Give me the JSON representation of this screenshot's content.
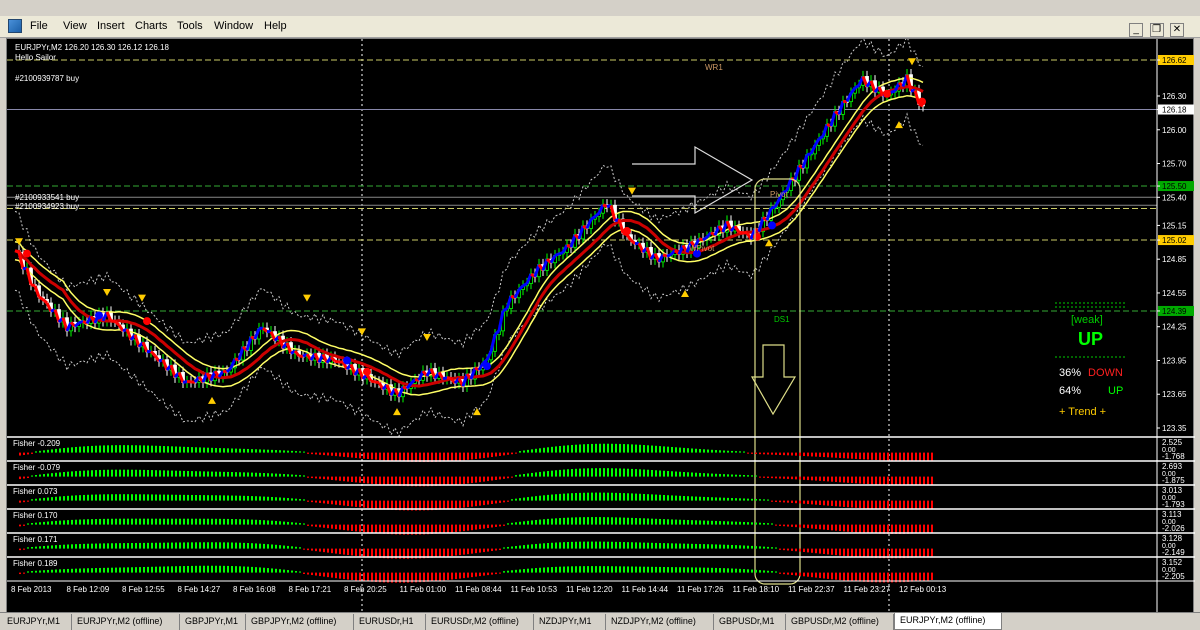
{
  "menu": [
    "File",
    "View",
    "Insert",
    "Charts",
    "Tools",
    "Window",
    "Help"
  ],
  "window_buttons": [
    "_",
    "❐",
    "✕"
  ],
  "chart": {
    "header_line": "EURJPYr,M2  126.20 126.30 126.12 126.18",
    "subtitle": "Hello Sailor",
    "order_labels": [
      "#2100939787 buy",
      "#2100933541 buy",
      "#2100934923 buy"
    ],
    "level_labels": [
      "WR1",
      "Pivot",
      "WPivot",
      "DS1"
    ],
    "price_axis": [
      "126.62",
      "126.30",
      "126.18",
      "126.00",
      "125.70",
      "125.50",
      "125.40",
      "125.15",
      "125.02",
      "124.85",
      "124.55",
      "124.39",
      "124.25",
      "123.95",
      "123.65",
      "123.35"
    ],
    "highlighted_prices": [
      "126.62",
      "125.50",
      "125.02",
      "124.39"
    ],
    "current_price": "126.18"
  },
  "panel": {
    "strength": "[weak]",
    "direction": "UP",
    "down_pct": "36%",
    "down_label": "DOWN",
    "up_pct": "64%",
    "up_label": "UP",
    "trend_label": "+ Trend +"
  },
  "fisher_panels": [
    {
      "label": "Fisher -0.209",
      "top": "2.525",
      "bottom": "-1.768"
    },
    {
      "label": "Fisher -0.079",
      "top": "2.693",
      "bottom": "-1.875"
    },
    {
      "label": "Fisher 0.073",
      "top": "3.013",
      "bottom": "-1.793"
    },
    {
      "label": "Fisher 0.170",
      "top": "3.113",
      "bottom": "-2.026"
    },
    {
      "label": "Fisher 0.171",
      "top": "3.128",
      "bottom": "-2.149"
    },
    {
      "label": "Fisher 0.189",
      "top": "3.152",
      "bottom": "-2.205"
    }
  ],
  "fisher_zero": "0.00",
  "time_axis": [
    "8 Feb 2013",
    "8 Feb 12:09",
    "8 Feb 12:55",
    "8 Feb 14:27",
    "8 Feb 16:08",
    "8 Feb 17:21",
    "8 Feb 20:25",
    "11 Feb 01:00",
    "11 Feb 08:44",
    "11 Feb 10:53",
    "11 Feb 12:20",
    "11 Feb 14:44",
    "11 Feb 17:26",
    "11 Feb 18:10",
    "11 Feb 22:37",
    "11 Feb 23:27",
    "12 Feb 00:13"
  ],
  "tabs": [
    "EURJPYr,M1",
    "EURJPYr,M2 (offline)",
    "GBPJPYr,M1",
    "GBPJPYr,M2 (offline)",
    "EURUSDr,H1",
    "EURUSDr,M2 (offline)",
    "NZDJPYr,M1",
    "NZDJPYr,M2 (offline)",
    "GBPUSDr,M1",
    "GBPUSDr,M2 (offline)",
    "EURJPYr,M2 (offline)"
  ],
  "active_tab": 10,
  "colors": {
    "bull": "#00ff00",
    "bear": "#ff0000",
    "trend_line": "#0000ff",
    "ma_yellow": "#ffff66",
    "ma_red": "#cc0000",
    "grid": "#ffffff",
    "highlight_price": "#00cc00",
    "amber": "#ffcc00"
  }
}
